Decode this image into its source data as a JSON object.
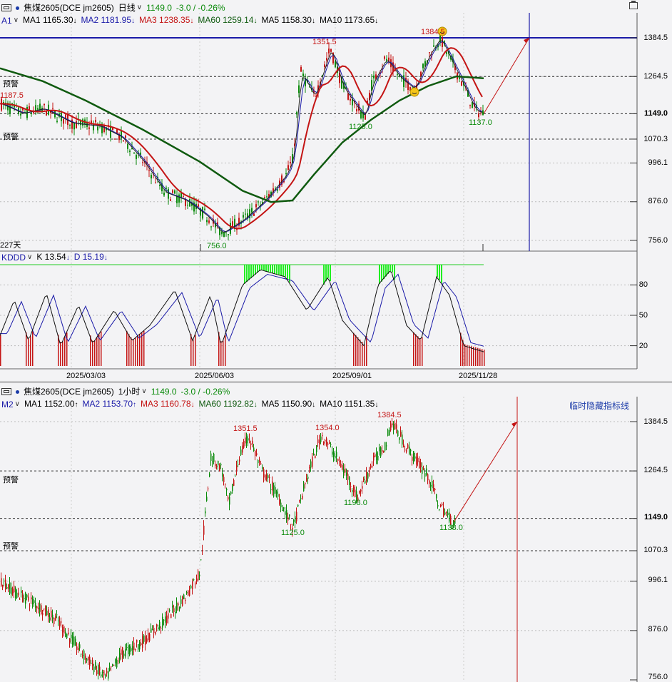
{
  "top": {
    "symbol": "焦煤2605(DCE jm2605)",
    "period": "日线",
    "price": "1149.0",
    "change": "-3.0 / -0.26%",
    "ma_row": {
      "tag": "A1",
      "items": [
        {
          "text": "MA1 1165.30",
          "arrow": "↓",
          "color": "#000000"
        },
        {
          "text": "MA2 1181.95",
          "arrow": "↓",
          "color": "#1a1aa8"
        },
        {
          "text": "MA3 1238.35",
          "arrow": "↓",
          "color": "#c41414"
        },
        {
          "text": "MA60 1259.14",
          "arrow": "↓",
          "color": "#0f5a0f"
        },
        {
          "text": "MA5 1158.30",
          "arrow": "↓",
          "color": "#000000"
        },
        {
          "text": "MA10 1173.65",
          "arrow": "↓",
          "color": "#000000"
        }
      ]
    },
    "axis": [
      "1384.5",
      "1264.5",
      "1149.0",
      "1070.3",
      "996.1",
      "876.0",
      "756.0"
    ],
    "warn_labels": [
      "预警",
      "预警"
    ],
    "annotations": {
      "left_high": "1187.5",
      "peak_1": "1351.5",
      "peak_2": "1384.5",
      "low_1": "1125.0",
      "low_2": "1137.0",
      "bottom": "756.0",
      "days": "227天"
    },
    "indicator": {
      "name": "KDDD",
      "k": "K 13.54",
      "d": "D 15.19",
      "axis": [
        "80",
        "50",
        "20"
      ]
    },
    "dates": [
      "2025/03/03",
      "2025/06/03",
      "2025/09/01",
      "2025/11/28"
    ]
  },
  "bottom": {
    "symbol": "焦煤2605(DCE jm2605)",
    "period": "1小时",
    "price": "1149.0",
    "change": "-3.0 / -0.26%",
    "ma_row": {
      "tag": "M2",
      "items": [
        {
          "text": "MA1 1152.00",
          "arrow": "↑",
          "color": "#000000"
        },
        {
          "text": "MA2 1153.70",
          "arrow": "↑",
          "color": "#1a1aa8"
        },
        {
          "text": "MA3 1160.78",
          "arrow": "↓",
          "color": "#c41414"
        },
        {
          "text": "MA60 1192.82",
          "arrow": "↓",
          "color": "#0f5a0f"
        },
        {
          "text": "MA5 1150.90",
          "arrow": "↓",
          "color": "#000000"
        },
        {
          "text": "MA10 1151.35",
          "arrow": "↓",
          "color": "#000000"
        }
      ]
    },
    "hidden_indicator": "临时隐藏指标线",
    "axis": [
      "1384.5",
      "1264.5",
      "1149.0",
      "1070.3",
      "996.1",
      "876.0",
      "756.0"
    ],
    "warn_labels": [
      "预警",
      "预警"
    ],
    "annotations": {
      "peak_1": "1351.5",
      "peak_2": "1354.0",
      "peak_3": "1384.5",
      "low_1": "1125.0",
      "low_2": "1198.0",
      "low_3": "1138.0"
    }
  },
  "chart_data": [
    {
      "type": "line",
      "title": "焦煤2605 日线",
      "ylim": [
        756.0,
        1384.5
      ],
      "reference_levels": [
        1384.5,
        1264.5,
        1149.0,
        1070.3
      ],
      "x": [
        "2025/03/03",
        "2025/06/03",
        "2025/09/01",
        "2025/11/28"
      ],
      "series": [
        {
          "name": "close",
          "values": [
            1200,
            1130,
            1080,
            960,
            860,
            780,
            820,
            1000,
            1300,
            1351.5,
            1200,
            1125,
            1300,
            1384.5,
            1264,
            1137,
            1149
          ]
        },
        {
          "name": "MA60",
          "values": [
            1290,
            1250,
            1180,
            1080,
            1000,
            900,
            860,
            870,
            990,
            1100,
            1180,
            1230,
            1265,
            1259
          ]
        }
      ],
      "grid": true
    },
    {
      "type": "line",
      "title": "KDDD",
      "ylim": [
        0,
        100
      ],
      "series": [
        {
          "name": "K",
          "values": [
            30,
            60,
            25,
            70,
            20,
            60,
            20,
            55,
            25,
            80,
            90,
            70,
            30,
            80,
            25,
            85,
            20,
            14
          ]
        },
        {
          "name": "D",
          "values": [
            40,
            50,
            35,
            60,
            30,
            50,
            30,
            50,
            35,
            70,
            85,
            75,
            40,
            70,
            35,
            75,
            25,
            15
          ]
        }
      ]
    },
    {
      "type": "line",
      "title": "焦煤2605 1小时",
      "ylim": [
        756.0,
        1384.5
      ],
      "reference_levels": [
        1264.5,
        1149.0,
        1070.3
      ],
      "series": [
        {
          "name": "close",
          "values": [
            1000,
            930,
            850,
            760,
            880,
            960,
            1120,
            1300,
            1351.5,
            1250,
            1125,
            1354.0,
            1198.0,
            1300,
            1384.5,
            1280,
            1138.0,
            1149
          ]
        }
      ]
    }
  ]
}
